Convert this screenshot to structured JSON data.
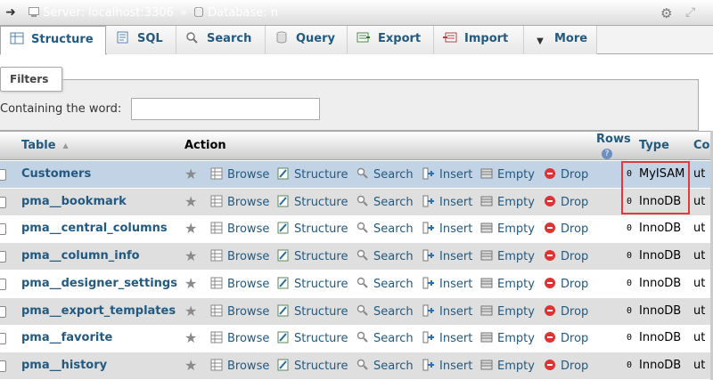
{
  "breadcrumb": {
    "server_label": "Server: localhost:3306",
    "separator": "»",
    "database_label": "Database: n"
  },
  "tabs": [
    {
      "label": "Structure",
      "icon": "structure-icon",
      "active": true
    },
    {
      "label": "SQL",
      "icon": "sql-icon",
      "active": false
    },
    {
      "label": "Search",
      "icon": "search-icon",
      "active": false
    },
    {
      "label": "Query",
      "icon": "query-icon",
      "active": false
    },
    {
      "label": "Export",
      "icon": "export-icon",
      "active": false
    },
    {
      "label": "Import",
      "icon": "import-icon",
      "active": false
    },
    {
      "label": "More",
      "icon": "chevron-down-icon",
      "active": false
    }
  ],
  "filters": {
    "legend": "Filters",
    "label": "Containing the word:",
    "value": ""
  },
  "table": {
    "columns": {
      "table": "Table",
      "action": "Action",
      "rows": "Rows",
      "type": "Type",
      "collation": "Co"
    },
    "actions": {
      "browse": "Browse",
      "structure": "Structure",
      "search": "Search",
      "insert": "Insert",
      "empty": "Empty",
      "drop": "Drop"
    },
    "rows": [
      {
        "name": "Customers",
        "rows": "0",
        "type": "MyISAM",
        "collation": "ut"
      },
      {
        "name": "pma__bookmark",
        "rows": "0",
        "type": "InnoDB",
        "collation": "ut"
      },
      {
        "name": "pma__central_columns",
        "rows": "0",
        "type": "InnoDB",
        "collation": "ut"
      },
      {
        "name": "pma__column_info",
        "rows": "0",
        "type": "InnoDB",
        "collation": "ut"
      },
      {
        "name": "pma__designer_settings",
        "rows": "0",
        "type": "InnoDB",
        "collation": "ut"
      },
      {
        "name": "pma__export_templates",
        "rows": "0",
        "type": "InnoDB",
        "collation": "ut"
      },
      {
        "name": "pma__favorite",
        "rows": "0",
        "type": "InnoDB",
        "collation": "ut"
      },
      {
        "name": "pma__history",
        "rows": "0",
        "type": "InnoDB",
        "collation": "ut"
      }
    ]
  },
  "colors": {
    "link": "#235a81",
    "highlight_row": "#c2d3e6",
    "annotation_box": "#e03a3a"
  }
}
